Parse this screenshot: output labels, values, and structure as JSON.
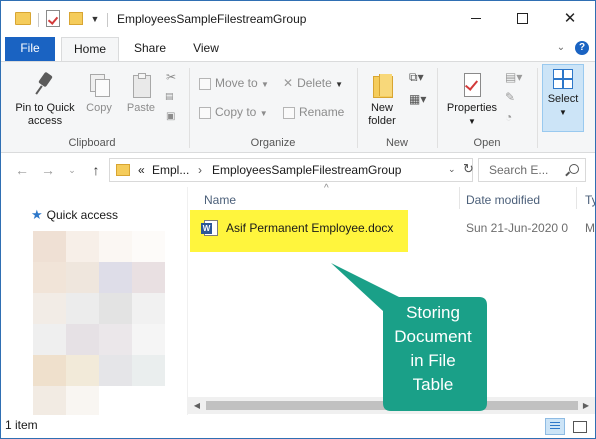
{
  "window": {
    "title": "EmployeesSampleFilestreamGroup"
  },
  "ribbon_tabs": [
    "File",
    "Home",
    "Share",
    "View"
  ],
  "ribbon": {
    "clipboard": {
      "label": "Clipboard",
      "pin": "Pin to Quick access",
      "copy": "Copy",
      "paste": "Paste"
    },
    "organize": {
      "label": "Organize",
      "move_to": "Move to",
      "copy_to": "Copy to",
      "delete": "Delete",
      "rename": "Rename"
    },
    "new": {
      "label": "New",
      "new_folder": "New folder"
    },
    "open": {
      "label": "Open",
      "properties": "Properties"
    },
    "select": {
      "label": "Select"
    }
  },
  "address": {
    "overflow": "«",
    "crumb1": "Empl...",
    "crumb2": "EmployeesSampleFilestreamGroup",
    "search_placeholder": "Search E..."
  },
  "nav": {
    "quick_access": "Quick access"
  },
  "columns": {
    "name": "Name",
    "date_modified": "Date modified",
    "type": "Ty"
  },
  "files": [
    {
      "name": "Asif Permanent Employee.docx",
      "date": "Sun 21-Jun-2020 0",
      "type": "M"
    }
  ],
  "callout": {
    "line1": "Storing",
    "line2": "Document",
    "line3": "in File",
    "line4": "Table",
    "color": "#1aa088"
  },
  "status": {
    "item_count": "1 item"
  },
  "colors": {
    "accent": "#1a63c2",
    "highlight": "#fff53d",
    "folder": "#f5cc5b"
  }
}
